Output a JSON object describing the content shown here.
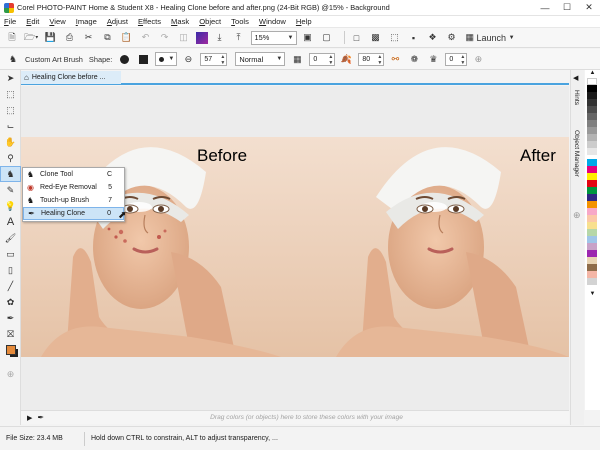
{
  "window": {
    "title": "Corel PHOTO-PAINT Home & Student X8 - Healing Clone before and after.png (24-Bit RGB) @15% - Background"
  },
  "menu": [
    "File",
    "Edit",
    "View",
    "Image",
    "Adjust",
    "Effects",
    "Mask",
    "Object",
    "Tools",
    "Window",
    "Help"
  ],
  "toolbar": {
    "zoom": "15%",
    "launch_label": "Launch"
  },
  "property_bar": {
    "brush_label": "Custom Art Brush",
    "shape_label": "Shape:",
    "size_value": "57",
    "merge_mode": "Normal",
    "transparency_value": "0",
    "soft_edge_value": "80",
    "nib_value": "0"
  },
  "doc_tab": {
    "label": "Healing Clone before ..."
  },
  "image": {
    "before_label": "Before",
    "after_label": "After"
  },
  "flyout": [
    {
      "label": "Clone Tool",
      "shortcut": "C"
    },
    {
      "label": "Red-Eye Removal",
      "shortcut": "5"
    },
    {
      "label": "Touch-up Brush",
      "shortcut": "7"
    },
    {
      "label": "Healing Clone",
      "shortcut": "0"
    }
  ],
  "dock_tabs": {
    "hints": "Hints",
    "object_manager": "Object Manager"
  },
  "color_bar": {
    "hint": "Drag colors (or objects) here to store these colors with your image"
  },
  "status": {
    "file_size": "File Size: 23.4 MB",
    "message": "Hold down CTRL to constrain, ALT to adjust transparency, ..."
  },
  "colors": {
    "accent": "#4aa3df",
    "selection": "#cce4f7",
    "skin": "#e9bfa2",
    "towel": "#f4f4f2"
  }
}
